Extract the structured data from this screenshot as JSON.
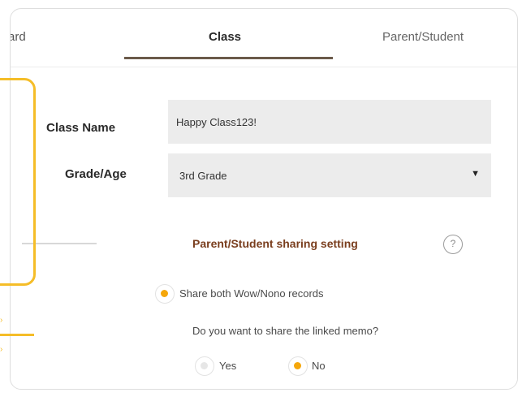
{
  "tabs": {
    "board": "ard",
    "class": "Class",
    "parent_student": "Parent/Student"
  },
  "form": {
    "class_name_label": "Class Name",
    "class_name_value": "Happy Class123!",
    "grade_label": "Grade/Age",
    "grade_value": "3rd Grade",
    "grade_arrow": "▼"
  },
  "sharing": {
    "title": "Parent/Student sharing setting",
    "help": "?",
    "share_both": "Share both Wow/Nono records",
    "memo_question": "Do you want to share the linked memo?",
    "yes": "Yes",
    "no": "No",
    "selected_share": "Share both Wow/Nono records",
    "selected_memo": "No"
  },
  "colors": {
    "accent": "#f5a70b",
    "highlight": "#f5bd28",
    "title_brown": "#7a3e1e",
    "tab_underline": "#6b5a4a"
  }
}
